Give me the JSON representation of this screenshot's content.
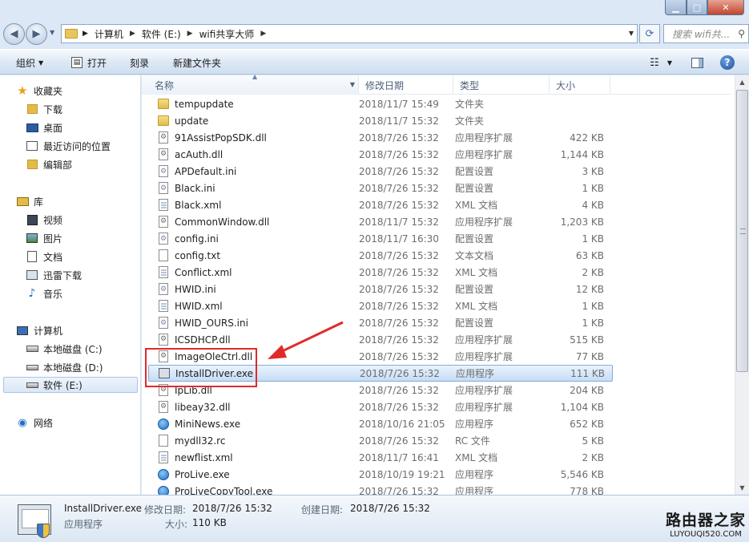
{
  "window": {
    "controls": {
      "minimize": "▁",
      "maximize": "□",
      "close": "✕"
    }
  },
  "address": {
    "crumbs": [
      "计算机",
      "软件 (E:)",
      "wifi共享大师"
    ],
    "search_placeholder": "搜索 wifi共...",
    "back_icon": "◀",
    "forward_icon": "▶"
  },
  "toolbar": {
    "organize": "组织",
    "open": "打开",
    "burn": "刻录",
    "new_folder": "新建文件夹"
  },
  "nav": {
    "favorites": {
      "label": "收藏夹",
      "items": [
        "下载",
        "桌面",
        "最近访问的位置",
        "编辑部"
      ]
    },
    "libraries": {
      "label": "库",
      "items": [
        "视频",
        "图片",
        "文档",
        "迅雷下载",
        "音乐"
      ]
    },
    "computer": {
      "label": "计算机",
      "items": [
        "本地磁盘 (C:)",
        "本地磁盘 (D:)",
        "软件 (E:)"
      ]
    },
    "network": {
      "label": "网络"
    },
    "selected": "软件 (E:)"
  },
  "columns": {
    "name": "名称",
    "date": "修改日期",
    "type": "类型",
    "size": "大小"
  },
  "files": [
    {
      "name": "tempupdate",
      "date": "2018/11/7 15:49",
      "type": "文件夹",
      "size": "",
      "icon": "folder"
    },
    {
      "name": "update",
      "date": "2018/11/7 15:32",
      "type": "文件夹",
      "size": "",
      "icon": "folder"
    },
    {
      "name": "91AssistPopSDK.dll",
      "date": "2018/7/26 15:32",
      "type": "应用程序扩展",
      "size": "422 KB",
      "icon": "dll"
    },
    {
      "name": "acAuth.dll",
      "date": "2018/7/26 15:32",
      "type": "应用程序扩展",
      "size": "1,144 KB",
      "icon": "dll"
    },
    {
      "name": "APDefault.ini",
      "date": "2018/7/26 15:32",
      "type": "配置设置",
      "size": "3 KB",
      "icon": "ini"
    },
    {
      "name": "Black.ini",
      "date": "2018/7/26 15:32",
      "type": "配置设置",
      "size": "1 KB",
      "icon": "ini"
    },
    {
      "name": "Black.xml",
      "date": "2018/7/26 15:32",
      "type": "XML 文档",
      "size": "4 KB",
      "icon": "xml"
    },
    {
      "name": "CommonWindow.dll",
      "date": "2018/11/7 15:32",
      "type": "应用程序扩展",
      "size": "1,203 KB",
      "icon": "dll"
    },
    {
      "name": "config.ini",
      "date": "2018/11/7 16:30",
      "type": "配置设置",
      "size": "1 KB",
      "icon": "ini"
    },
    {
      "name": "config.txt",
      "date": "2018/7/26 15:32",
      "type": "文本文档",
      "size": "63 KB",
      "icon": "file"
    },
    {
      "name": "Conflict.xml",
      "date": "2018/7/26 15:32",
      "type": "XML 文档",
      "size": "2 KB",
      "icon": "xml"
    },
    {
      "name": "HWID.ini",
      "date": "2018/7/26 15:32",
      "type": "配置设置",
      "size": "12 KB",
      "icon": "ini"
    },
    {
      "name": "HWID.xml",
      "date": "2018/7/26 15:32",
      "type": "XML 文档",
      "size": "1 KB",
      "icon": "xml"
    },
    {
      "name": "HWID_OURS.ini",
      "date": "2018/7/26 15:32",
      "type": "配置设置",
      "size": "1 KB",
      "icon": "ini"
    },
    {
      "name": "ICSDHCP.dll",
      "date": "2018/7/26 15:32",
      "type": "应用程序扩展",
      "size": "515 KB",
      "icon": "dll"
    },
    {
      "name": "ImageOleCtrl.dll",
      "date": "2018/7/26 15:32",
      "type": "应用程序扩展",
      "size": "77 KB",
      "icon": "dll"
    },
    {
      "name": "InstallDriver.exe",
      "date": "2018/7/26 15:32",
      "type": "应用程序",
      "size": "111 KB",
      "icon": "exe"
    },
    {
      "name": "IpLib.dll",
      "date": "2018/7/26 15:32",
      "type": "应用程序扩展",
      "size": "204 KB",
      "icon": "dll"
    },
    {
      "name": "libeay32.dll",
      "date": "2018/7/26 15:32",
      "type": "应用程序扩展",
      "size": "1,104 KB",
      "icon": "dll"
    },
    {
      "name": "MiniNews.exe",
      "date": "2018/10/16 21:05",
      "type": "应用程序",
      "size": "652 KB",
      "icon": "globe"
    },
    {
      "name": "mydll32.rc",
      "date": "2018/7/26 15:32",
      "type": "RC 文件",
      "size": "5 KB",
      "icon": "file"
    },
    {
      "name": "newflist.xml",
      "date": "2018/11/7 16:41",
      "type": "XML 文档",
      "size": "2 KB",
      "icon": "xml"
    },
    {
      "name": "ProLive.exe",
      "date": "2018/10/19 19:21",
      "type": "应用程序",
      "size": "5,546 KB",
      "icon": "globe"
    },
    {
      "name": "ProLiveCopyTool.exe",
      "date": "2018/7/26 15:32",
      "type": "应用程序",
      "size": "778 KB",
      "icon": "globe"
    }
  ],
  "selected_file": "InstallDriver.exe",
  "details": {
    "name": "InstallDriver.exe",
    "type": "应用程序",
    "modified_label": "修改日期:",
    "modified": "2018/7/26 15:32",
    "created_label": "创建日期:",
    "created": "2018/7/26 15:32",
    "size_label": "大小:",
    "size": "110 KB"
  },
  "watermark": {
    "title": "路由器之家",
    "url": "LUYOUQI520.COM"
  },
  "colors": {
    "annotation": "#e02a2a",
    "selection": "#c5dcf6"
  }
}
